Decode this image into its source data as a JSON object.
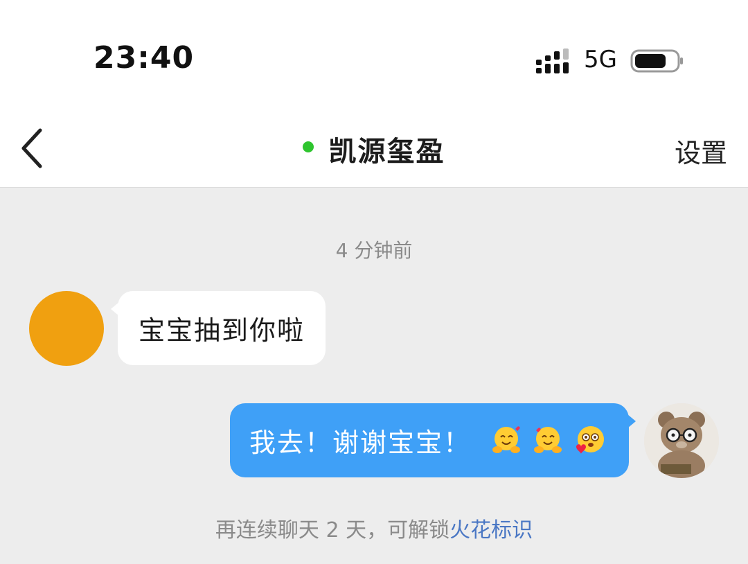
{
  "status_bar": {
    "time": "23:40",
    "network": "5G",
    "icons": [
      "signal-icon",
      "battery-icon"
    ]
  },
  "nav": {
    "back_icon": "chevron-left-icon",
    "title": "凯源玺盈",
    "online": true,
    "online_color": "#2fc52f",
    "settings_label": "设置"
  },
  "chat": {
    "timestamp": "4 分钟前",
    "messages": [
      {
        "side": "left",
        "text": "宝宝抽到你啦",
        "avatar_color": "#f0a010",
        "bubble_color": "#ffffff"
      },
      {
        "side": "right",
        "text": "我去！谢谢宝宝！",
        "emojis": [
          "hugging-face-emoji",
          "hugging-face-emoji",
          "smiling-face-with-heart-emoji"
        ],
        "bubble_color": "#3fa0f7",
        "avatar": "teddy-bear-avatar"
      }
    ]
  },
  "footer": {
    "prefix": "再连续聊天 2 天，可解锁",
    "link": "火花标识",
    "link_color": "#4a77c4"
  },
  "colors": {
    "background": "#ededed",
    "bar_background": "#ffffff"
  }
}
